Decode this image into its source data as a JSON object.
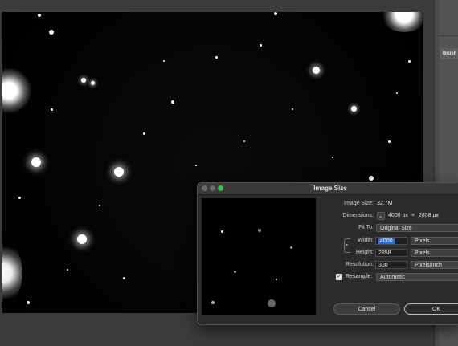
{
  "dialog": {
    "title": "Image Size",
    "image_size_label": "Image Size:",
    "image_size_value": "32.7M",
    "dimensions_label": "Dimensions:",
    "dimensions_width": "4000 px",
    "dimensions_sep": "×",
    "dimensions_height": "2858 px",
    "fit_to_label": "Fit To:",
    "fit_to_value": "Original Size",
    "width_label": "Width:",
    "width_value": "4000",
    "width_unit": "Pixels",
    "height_label": "Height:",
    "height_value": "2858",
    "height_unit": "Pixels",
    "resolution_label": "Resolution:",
    "resolution_value": "300",
    "resolution_unit": "Pixels/Inch",
    "resample_label": "Resample:",
    "resample_value": "Automatic",
    "resample_checked": true,
    "cancel_label": "Cancel",
    "ok_label": "OK"
  },
  "panel": {
    "tab_label": "Brush"
  },
  "colors": {
    "accent": "#2f6fd6",
    "dialog_bg": "#2b2b2b",
    "workspace_bg": "#3b3b3b"
  }
}
